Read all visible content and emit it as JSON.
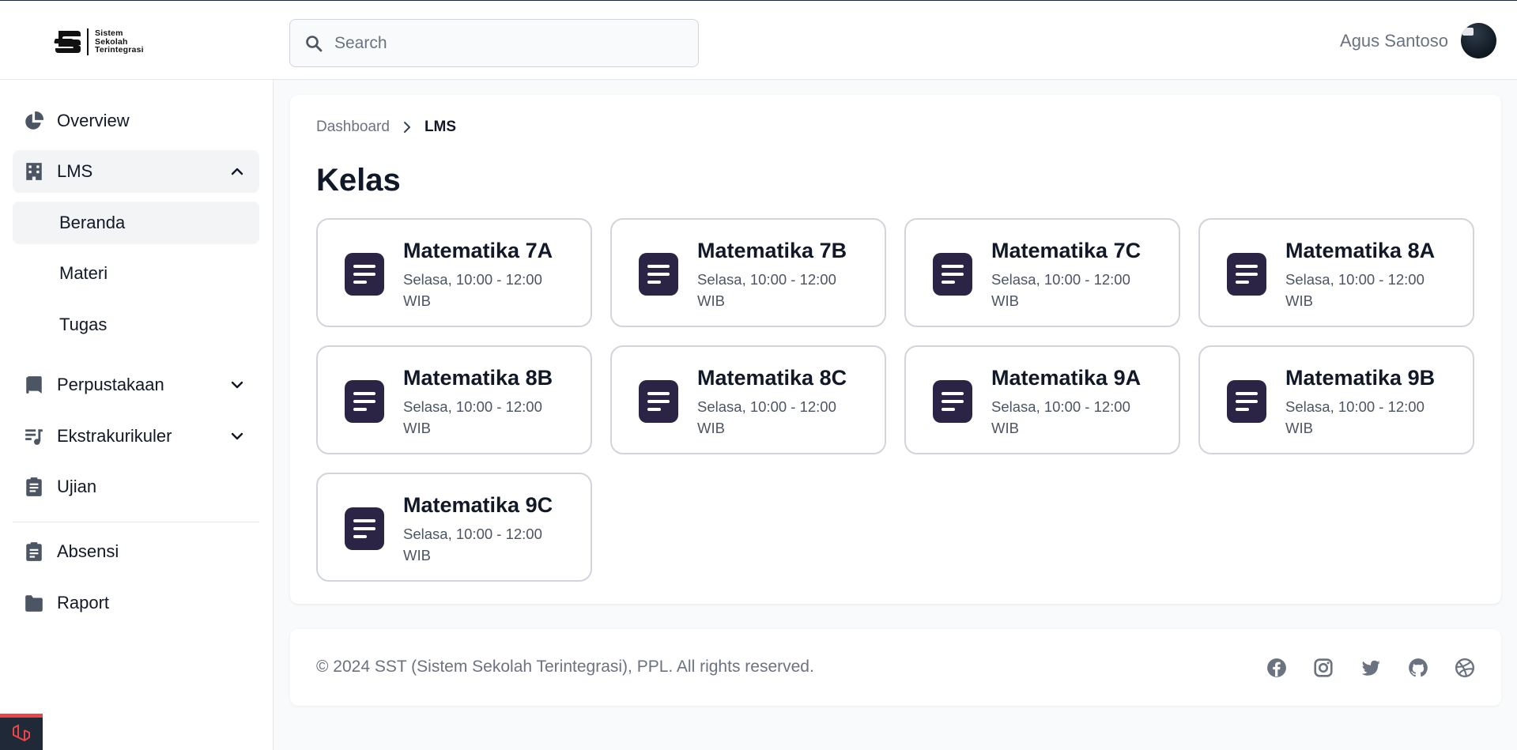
{
  "app": {
    "logo_text_lines": [
      "Sistem",
      "Sekolah",
      "Terintegrasi"
    ]
  },
  "search": {
    "placeholder": "Search",
    "value": ""
  },
  "user": {
    "name": "Agus Santoso"
  },
  "sidebar": {
    "items": [
      {
        "label": "Overview",
        "icon": "pie-chart-icon"
      },
      {
        "label": "LMS",
        "icon": "building-icon",
        "expanded": true
      },
      {
        "label": "Perpustakaan",
        "icon": "book-icon",
        "expanded": false
      },
      {
        "label": "Ekstrakurikuler",
        "icon": "music-list-icon",
        "expanded": false
      },
      {
        "label": "Ujian",
        "icon": "clipboard-list-icon"
      },
      {
        "label": "Absensi",
        "icon": "clipboard-user-icon"
      },
      {
        "label": "Raport",
        "icon": "folder-icon"
      }
    ],
    "lms_subitems": [
      {
        "label": "Beranda",
        "active": true
      },
      {
        "label": "Materi",
        "active": false
      },
      {
        "label": "Tugas",
        "active": false
      }
    ]
  },
  "breadcrumb": {
    "root": "Dashboard",
    "current": "LMS"
  },
  "page": {
    "title": "Kelas"
  },
  "classes": [
    {
      "name": "Matematika 7A",
      "schedule": "Selasa, 10:00 - 12:00 WIB"
    },
    {
      "name": "Matematika 7B",
      "schedule": "Selasa, 10:00 - 12:00 WIB"
    },
    {
      "name": "Matematika 7C",
      "schedule": "Selasa, 10:00 - 12:00 WIB"
    },
    {
      "name": "Matematika 8A",
      "schedule": "Selasa, 10:00 - 12:00 WIB"
    },
    {
      "name": "Matematika 8B",
      "schedule": "Selasa, 10:00 - 12:00 WIB"
    },
    {
      "name": "Matematika 8C",
      "schedule": "Selasa, 10:00 - 12:00 WIB"
    },
    {
      "name": "Matematika 9A",
      "schedule": "Selasa, 10:00 - 12:00 WIB"
    },
    {
      "name": "Matematika 9B",
      "schedule": "Selasa, 10:00 - 12:00 WIB"
    },
    {
      "name": "Matematika 9C",
      "schedule": "Selasa, 10:00 - 12:00 WIB"
    }
  ],
  "footer": {
    "copyright": "© 2024 SST (Sistem Sekolah Terintegrasi), PPL. All rights reserved.",
    "social": [
      "facebook-icon",
      "instagram-icon",
      "twitter-icon",
      "github-icon",
      "dribbble-icon"
    ]
  },
  "colors": {
    "class_icon_bg": "#2b2445",
    "card_border": "#d1d5db",
    "active_bg": "#f3f4f6",
    "muted_text": "#6b7280",
    "laravel_red": "#ef4444"
  }
}
